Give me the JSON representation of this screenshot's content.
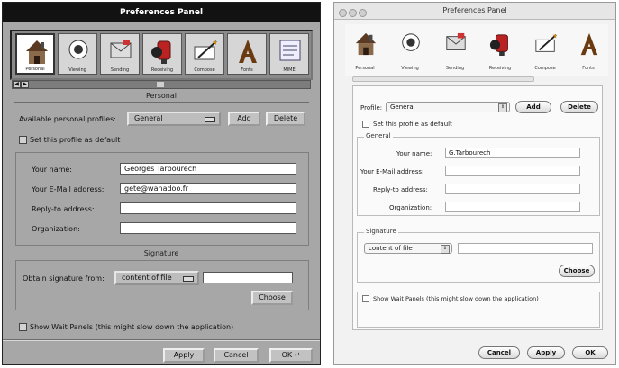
{
  "left": {
    "title": "Preferences Panel",
    "icons": [
      {
        "label": "Personal",
        "icon": "house-icon",
        "selected": true
      },
      {
        "label": "Viewing",
        "icon": "eye-icon",
        "selected": false
      },
      {
        "label": "Sending",
        "icon": "outbox-icon",
        "selected": false
      },
      {
        "label": "Receiving",
        "icon": "mailbox-icon",
        "selected": false
      },
      {
        "label": "Compose",
        "icon": "compose-icon",
        "selected": false
      },
      {
        "label": "Fonts",
        "icon": "font-a-icon",
        "selected": false
      },
      {
        "label": "MIME",
        "icon": "mime-icon",
        "selected": false
      }
    ],
    "section_personal": "Personal",
    "profiles_label": "Available personal profiles:",
    "profile_selected": "General",
    "add_label": "Add",
    "delete_label": "Delete",
    "default_label": "Set this profile as default",
    "name_label": "Your name:",
    "name_value": "Georges Tarbourech",
    "email_label": "Your E-Mail address:",
    "email_value": "gete@wanadoo.fr",
    "reply_label": "Reply-to address:",
    "reply_value": "",
    "org_label": "Organization:",
    "org_value": "",
    "section_signature": "Signature",
    "sig_label": "Obtain signature from:",
    "sig_source": "content of file",
    "sig_path": "",
    "choose_label": "Choose",
    "wait_label": "Show Wait Panels (this might slow down the application)",
    "apply_label": "Apply",
    "cancel_label": "Cancel",
    "ok_label": "OK"
  },
  "right": {
    "title": "Preferences Panel",
    "icons": [
      {
        "label": "Personal",
        "icon": "house-icon"
      },
      {
        "label": "Viewing",
        "icon": "eye-icon"
      },
      {
        "label": "Sending",
        "icon": "outbox-icon"
      },
      {
        "label": "Receiving",
        "icon": "mailbox-icon"
      },
      {
        "label": "Compose",
        "icon": "compose-icon"
      },
      {
        "label": "Fonts",
        "icon": "font-a-icon"
      }
    ],
    "profile_label": "Profile:",
    "profile_selected": "General",
    "add_label": "Add",
    "delete_label": "Delete",
    "default_label": "Set this profile as default",
    "general_head": "General",
    "name_label": "Your name:",
    "name_value": "G.Tarbourech",
    "email_label": "Your E-Mail address:",
    "email_value": "",
    "reply_label": "Reply-to address:",
    "reply_value": "",
    "org_label": "Organization:",
    "org_value": "",
    "signature_head": "Signature",
    "sig_source": "content of file",
    "sig_path": "",
    "choose_label": "Choose",
    "wait_label": "Show Wait Panels (this might slow down the application)",
    "cancel_label": "Cancel",
    "apply_label": "Apply",
    "ok_label": "OK"
  }
}
